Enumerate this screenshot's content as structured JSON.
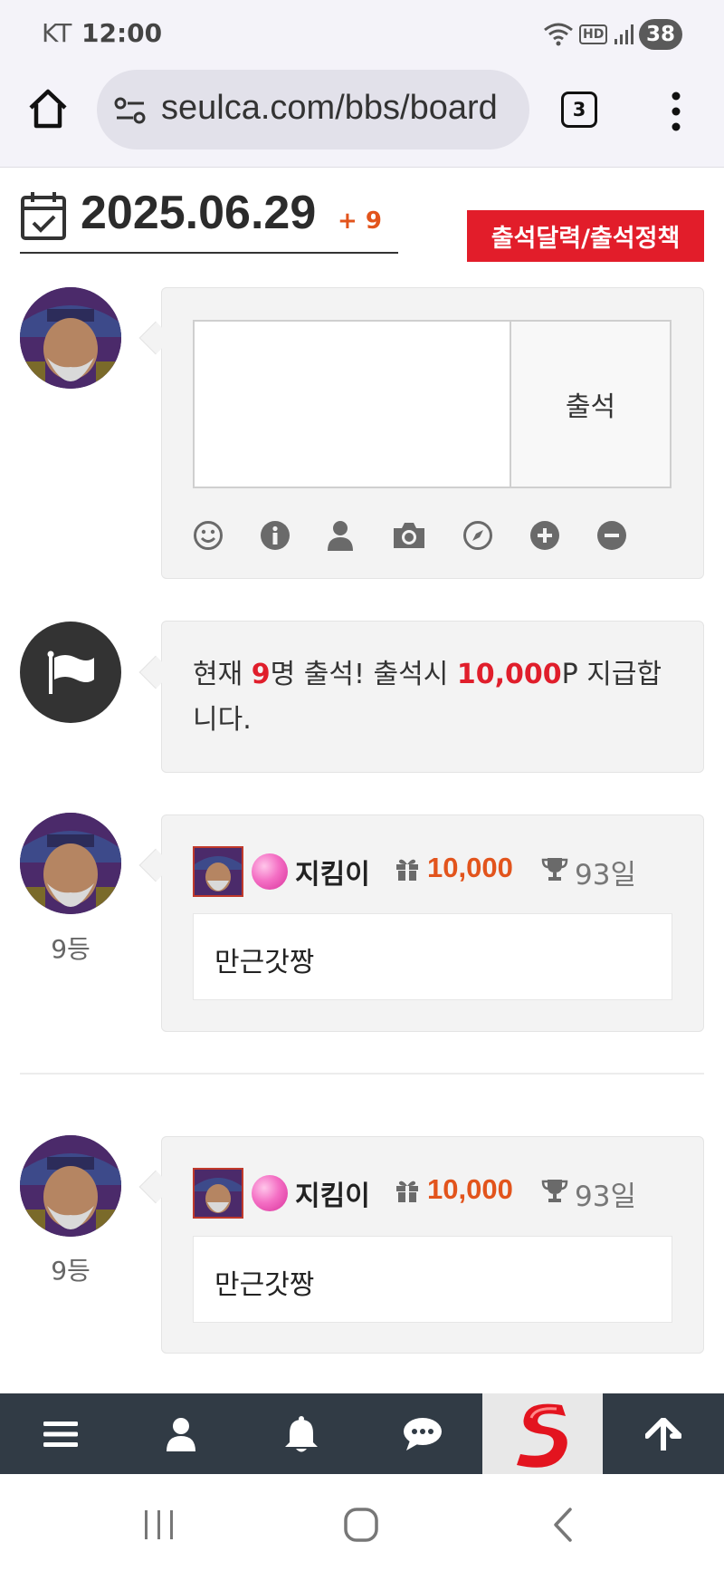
{
  "status_bar": {
    "carrier": "KT",
    "time": "12:00",
    "battery": "38",
    "hd_label": "HD"
  },
  "browser": {
    "url": "seulca.com/bbs/board",
    "tab_count": "3"
  },
  "header": {
    "date": "2025.06.29",
    "count_badge": "+ 9",
    "policy_button": "출석달력/출석정책"
  },
  "composer": {
    "textarea_value": "",
    "submit_label": "출석",
    "tools": [
      "smile-icon",
      "info-icon",
      "user-icon",
      "camera-icon",
      "compass-icon",
      "plus-circle-icon",
      "minus-circle-icon"
    ]
  },
  "notice": {
    "prefix": "현재 ",
    "count": "9",
    "middle": "명 출석! 출석시 ",
    "points": "10,000",
    "suffix": "P 지급합니다."
  },
  "entries": [
    {
      "rank": "9등",
      "nickname": "지킴이",
      "points": "10,000",
      "days": "93일",
      "message": "만근갓짱"
    },
    {
      "rank": "9등",
      "nickname": "지킴이",
      "points": "10,000",
      "days": "93일",
      "message": "만근갓짱"
    }
  ],
  "bottom_nav": [
    "menu-icon",
    "user-icon",
    "bell-icon",
    "chat-icon",
    "site-logo",
    "arrow-up-icon"
  ],
  "colors": {
    "accent_red": "#e21d2a",
    "points_orange": "#e2541c",
    "nav_bg": "#313b45"
  }
}
